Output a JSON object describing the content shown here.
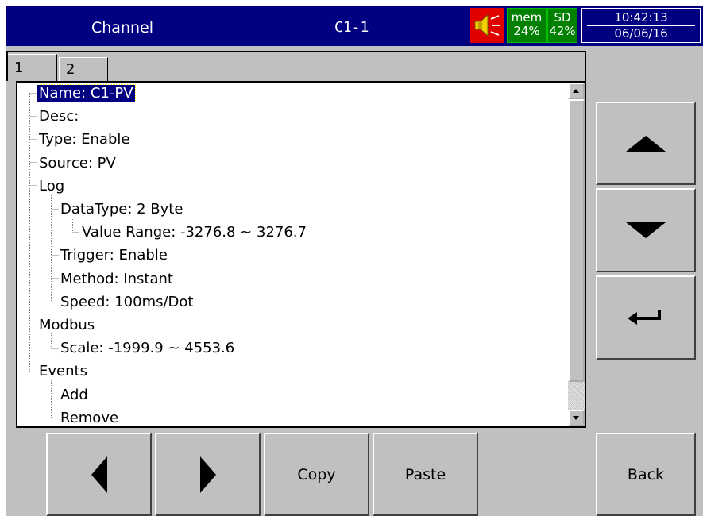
{
  "header": {
    "title": "Channel",
    "channel_id": "C1-1",
    "mem_label": "mem",
    "mem_value": "24%",
    "sd_label": "SD",
    "sd_value": "42%",
    "time": "10:42:13",
    "date": "06/06/16",
    "alarm_icon": "speaker-alarm-icon"
  },
  "tabs": [
    {
      "label": "1",
      "active": true
    },
    {
      "label": "2",
      "active": false
    }
  ],
  "tree": [
    {
      "label": "Name: C1-PV",
      "depth": 0,
      "selected": true
    },
    {
      "label": "Desc:",
      "depth": 0
    },
    {
      "label": "Type: Enable",
      "depth": 0
    },
    {
      "label": "Source: PV",
      "depth": 0
    },
    {
      "label": "Log",
      "depth": 0
    },
    {
      "label": "DataType: 2 Byte",
      "depth": 1
    },
    {
      "label": "Value Range: -3276.8 ~ 3276.7",
      "depth": 2
    },
    {
      "label": "Trigger: Enable",
      "depth": 1
    },
    {
      "label": "Method: Instant",
      "depth": 1
    },
    {
      "label": "Speed: 100ms/Dot",
      "depth": 1
    },
    {
      "label": "Modbus",
      "depth": 0
    },
    {
      "label": "Scale: -1999.9 ~ 4553.6",
      "depth": 1
    },
    {
      "label": "Events",
      "depth": 0
    },
    {
      "label": "Add",
      "depth": 1
    },
    {
      "label": "Remove",
      "depth": 1
    }
  ],
  "buttons": {
    "up_icon": "triangle-up-icon",
    "down_icon": "triangle-down-icon",
    "enter_icon": "enter-arrow-icon",
    "left_icon": "triangle-left-icon",
    "right_icon": "triangle-right-icon",
    "copy": "Copy",
    "paste": "Paste",
    "back": "Back"
  },
  "colors": {
    "header_bg": "#000080",
    "alarm_bg": "#e00000",
    "status_bg": "#008000",
    "selection_bg": "#000080",
    "panel_bg": "#c0c0c0"
  }
}
